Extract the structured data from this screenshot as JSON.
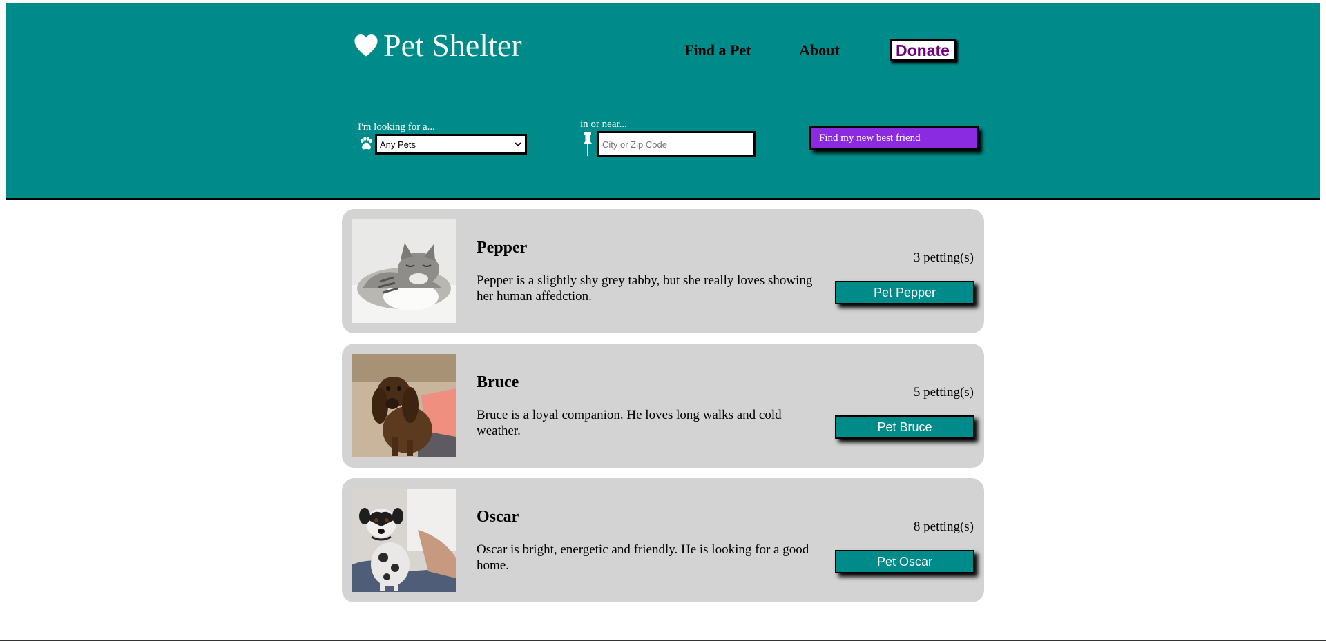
{
  "header": {
    "brand_icon": "heart-icon",
    "title": "Pet Shelter",
    "nav": {
      "find_label": "Find a Pet",
      "about_label": "About",
      "donate_label": "Donate"
    },
    "colors": {
      "header_bg": "#008b8b",
      "donate_text": "#6f007f",
      "search_button": "#8a2be2"
    }
  },
  "search": {
    "pet_label": "I'm looking for a...",
    "pet_icon": "paw-icon",
    "pet_selected": "Any Pets",
    "location_label": "in or near...",
    "location_icon": "pushpin-icon",
    "location_placeholder": "City or Zip Code",
    "location_value": "",
    "submit_label": "Find my new best friend"
  },
  "pets": [
    {
      "name": "Pepper",
      "description": "Pepper is a slightly shy grey tabby, but she really loves showing her human affedction.",
      "count_text": "3 petting(s)",
      "button_label": "Pet Pepper",
      "photo": "grey-tabby-cat-photo"
    },
    {
      "name": "Bruce",
      "description": "Bruce is a loyal companion. He loves long walks and cold weather.",
      "count_text": "5 petting(s)",
      "button_label": "Pet Bruce",
      "photo": "brown-dachshund-photo"
    },
    {
      "name": "Oscar",
      "description": "Oscar is bright, energetic and friendly. He is looking for a good home.",
      "count_text": "8 petting(s)",
      "button_label": "Pet Oscar",
      "photo": "spotted-puppy-photo"
    }
  ]
}
